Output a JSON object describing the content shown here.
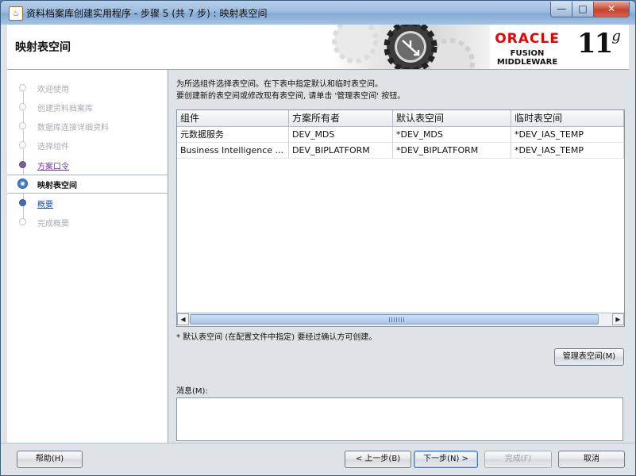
{
  "window": {
    "title": "资料档案库创建实用程序 - 步骤 5 (共 7 步) : 映射表空间",
    "app_icon_glyph": "♨",
    "minimize_glyph": "—",
    "maximize_glyph": "□",
    "close_glyph": "✕"
  },
  "banner": {
    "page_title": "映射表空间",
    "brand_name": "ORACLE",
    "product_name": "FUSION MIDDLEWARE",
    "version_number": "11",
    "version_suffix": "g"
  },
  "nav": {
    "items": [
      {
        "label": "欢迎使用",
        "state": "inactive"
      },
      {
        "label": "创建资料档案库",
        "state": "inactive"
      },
      {
        "label": "数据库连接详细资料",
        "state": "inactive"
      },
      {
        "label": "选择组件",
        "state": "inactive"
      },
      {
        "label": "方案口令",
        "state": "done"
      },
      {
        "label": "映射表空间",
        "state": "current"
      },
      {
        "label": "概要",
        "state": "next"
      },
      {
        "label": "完成概要",
        "state": "inactive"
      }
    ]
  },
  "content": {
    "instruction_line1": "为所选组件选择表空间。在下表中指定默认和临时表空间。",
    "instruction_line2": "要创建新的表空间或修改现有表空间, 请单击 '管理表空间' 按钮。",
    "table": {
      "headers": [
        "组件",
        "方案所有者",
        "默认表空间",
        "临时表空间"
      ],
      "rows": [
        [
          "元数据服务",
          "DEV_MDS",
          "*DEV_MDS",
          "*DEV_IAS_TEMP"
        ],
        [
          "Business Intelligence ...",
          "DEV_BIPLATFORM",
          "*DEV_BIPLATFORM",
          "*DEV_IAS_TEMP"
        ]
      ]
    },
    "note": "* 默认表空间 (在配置文件中指定) 要经过确认方可创建。",
    "manage_button": "管理表空间(M)",
    "message_label": "消息(M):"
  },
  "footer": {
    "help_button": "帮助(H)",
    "back_button": "< 上一步(B)",
    "next_button": "下一步(N) >",
    "finish_button": "完成(F)",
    "cancel_button": "取消"
  },
  "colors": {
    "accent_blue": "#3e6fb5",
    "done_purple": "#6a3b9c",
    "oracle_red": "#e00000"
  }
}
